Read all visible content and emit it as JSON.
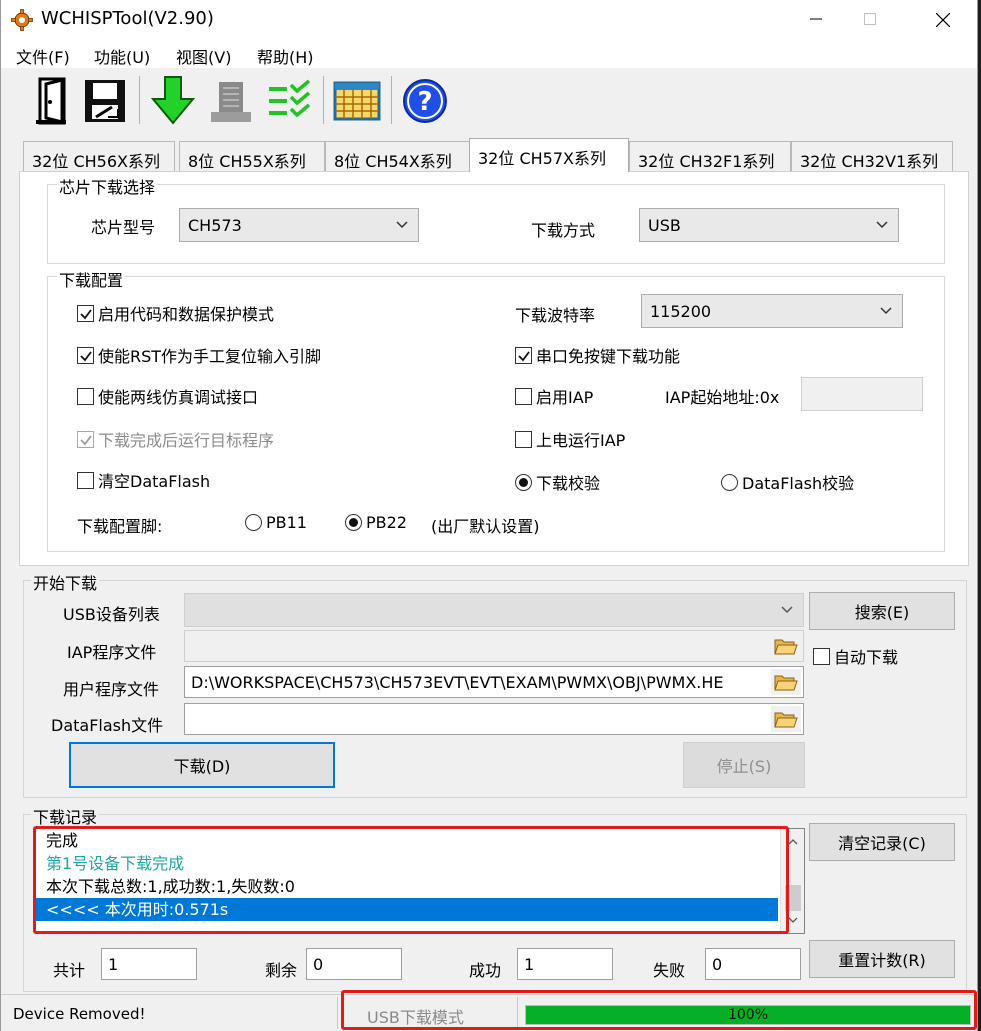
{
  "window": {
    "title": "WCHISPTool(V2.90)"
  },
  "menu": [
    "文件(F)",
    "功能(U)",
    "视图(V)",
    "帮助(H)"
  ],
  "toolbar": {
    "icons": [
      "door-open-icon",
      "save-disk-icon",
      "download-arrow-icon",
      "chip-icon",
      "checklist-icon",
      "calendar-grid-icon",
      "help-icon"
    ],
    "help_glyph": "?"
  },
  "tabs": [
    "32位 CH56X系列",
    "8位 CH55X系列",
    "8位 CH54X系列",
    "32位 CH57X系列",
    "32位 CH32F1系列",
    "32位 CH32V1系列"
  ],
  "active_tab": 3,
  "chip_select": {
    "group_title": "芯片下载选择",
    "chip_model_label": "芯片型号",
    "chip_model_value": "CH573",
    "download_mode_label": "下载方式",
    "download_mode_value": "USB"
  },
  "download_config": {
    "group_title": "下载配置",
    "opt_protect": "启用代码和数据保护模式",
    "opt_rst": "使能RST作为手工复位输入引脚",
    "opt_two_wire": "使能两线仿真调试接口",
    "opt_run_after": "下载完成后运行目标程序",
    "opt_clear_dataflash": "清空DataFlash",
    "baud_label": "下载波特率",
    "baud_value": "115200",
    "opt_serial_no_key": "串口免按键下载功能",
    "opt_enable_iap": "启用IAP",
    "iap_addr_label": "IAP起始地址:0x",
    "iap_addr_value": "",
    "opt_power_on_iap": "上电运行IAP",
    "radio_verify": "下载校验",
    "radio_dataflash_verify": "DataFlash校验",
    "config_pin_label": "下载配置脚:",
    "pin_pb11": "PB11",
    "pin_pb22": "PB22",
    "pin_note": "(出厂默认设置)"
  },
  "start": {
    "group_title": "开始下载",
    "usb_list_label": "USB设备列表",
    "usb_list_value": "",
    "search_button": "搜索(E)",
    "auto_download": "自动下载",
    "iap_file_label": "IAP程序文件",
    "iap_file_value": "",
    "user_file_label": "用户程序文件",
    "user_file_value": "D:\\WORKSPACE\\CH573\\CH573EVT\\EVT\\EXAM\\PWMX\\OBJ\\PWMX.HE",
    "dataflash_file_label": "DataFlash文件",
    "dataflash_file_value": "",
    "download_button": "下载(D)",
    "stop_button": "停止(S)"
  },
  "log": {
    "group_title": "下载记录",
    "lines": [
      {
        "text": "完成",
        "style": "normal"
      },
      {
        "text": "第1号设备下载完成",
        "style": "teal"
      },
      {
        "text": "本次下载总数:1,成功数:1,失败数:0",
        "style": "normal"
      },
      {
        "text": "<<<< 本次用时:0.571s",
        "style": "selected"
      }
    ],
    "clear_button": "清空记录(C)",
    "reset_button": "重置计数(R)",
    "total_label": "共计",
    "total_value": "1",
    "remaining_label": "剩余",
    "remaining_value": "0",
    "success_label": "成功",
    "success_value": "1",
    "fail_label": "失败",
    "fail_value": "0"
  },
  "status": {
    "left_text": "Device Removed!",
    "mode_text": "USB下载模式",
    "progress_text": "100%",
    "progress_fraction": 1.0,
    "progress_color": "#06b025",
    "highlight_color": "#e01b1b"
  }
}
